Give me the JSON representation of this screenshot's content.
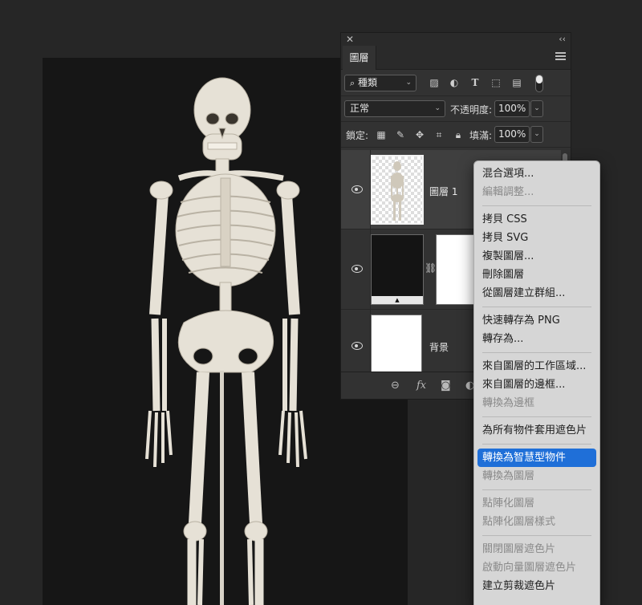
{
  "panel": {
    "close_glyph": "✕",
    "collapse_glyph": "‹‹",
    "tab_label": "圖層",
    "filter": {
      "value": "種類",
      "icon": "search-icon"
    },
    "blend_mode": "正常",
    "opacity_label": "不透明度:",
    "opacity_value": "100%",
    "lock_label": "鎖定:",
    "fill_label": "填滿:",
    "fill_value": "100%",
    "layers": [
      {
        "name": "圖層 1",
        "selected": true,
        "thumb": "transparent-skeleton"
      },
      {
        "name": "",
        "selected": false,
        "thumb": "adjustment-with-mask"
      },
      {
        "name": "背景",
        "selected": false,
        "thumb": "white"
      }
    ],
    "footer_fx": "fx"
  },
  "context_menu": {
    "items": [
      {
        "label": "混合選項...",
        "enabled": true
      },
      {
        "label": "編輯調整...",
        "enabled": false
      },
      {
        "label": "拷貝 CSS",
        "enabled": true
      },
      {
        "label": "拷貝 SVG",
        "enabled": true
      },
      {
        "label": "複製圖層...",
        "enabled": true
      },
      {
        "label": "刪除圖層",
        "enabled": true
      },
      {
        "label": "從圖層建立群組...",
        "enabled": true
      },
      {
        "label": "快速轉存為 PNG",
        "enabled": true
      },
      {
        "label": "轉存為...",
        "enabled": true
      },
      {
        "label": "來自圖層的工作區域...",
        "enabled": true
      },
      {
        "label": "來自圖層的邊框...",
        "enabled": true
      },
      {
        "label": "轉換為邊框",
        "enabled": false
      },
      {
        "label": "為所有物件套用遮色片",
        "enabled": true
      },
      {
        "label": "轉換為智慧型物件",
        "enabled": true,
        "highlighted": true
      },
      {
        "label": "轉換為圖層",
        "enabled": false
      },
      {
        "label": "點陣化圖層",
        "enabled": false
      },
      {
        "label": "點陣化圖層樣式",
        "enabled": false
      },
      {
        "label": "關閉圖層遮色片",
        "enabled": false
      },
      {
        "label": "啟動向量圖層遮色片",
        "enabled": false
      },
      {
        "label": "建立剪裁遮色片",
        "enabled": true
      }
    ]
  },
  "colors": {
    "app_bg": "#262626",
    "panel_bg": "#323232",
    "menu_bg": "#d6d6d6",
    "highlight": "#1f6fd8"
  }
}
